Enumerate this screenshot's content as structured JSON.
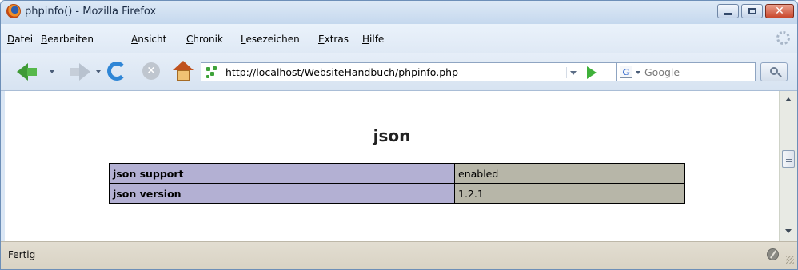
{
  "window": {
    "title": "phpinfo() - Mozilla Firefox"
  },
  "menu": {
    "items": [
      {
        "first": "D",
        "rest": "atei"
      },
      {
        "first": "B",
        "rest": "earbeiten"
      },
      {
        "first": "A",
        "rest": "nsicht"
      },
      {
        "first": "C",
        "rest": "hronik"
      },
      {
        "first": "L",
        "rest": "esezeichen"
      },
      {
        "first": "E",
        "rest": "xtras"
      },
      {
        "first": "H",
        "rest": "ilfe"
      }
    ]
  },
  "navigation": {
    "url": "http://localhost/WebsiteHandbuch/phpinfo.php",
    "search_engine_letter": "G",
    "search_placeholder": "Google"
  },
  "page": {
    "heading": "json",
    "rows": [
      {
        "label": "json support",
        "value": "enabled"
      },
      {
        "label": "json version",
        "value": "1.2.1"
      }
    ]
  },
  "status": {
    "text": "Fertig"
  },
  "colors": {
    "label_cell": "#b3b0d3",
    "value_cell": "#b7b6a8",
    "close_button": "#c9472c"
  },
  "icons": [
    "firefox-icon",
    "back-icon",
    "forward-icon",
    "reload-icon",
    "stop-icon",
    "home-icon",
    "site-icon",
    "go-icon",
    "google-icon",
    "search-icon",
    "throbber-icon",
    "status-icon"
  ]
}
